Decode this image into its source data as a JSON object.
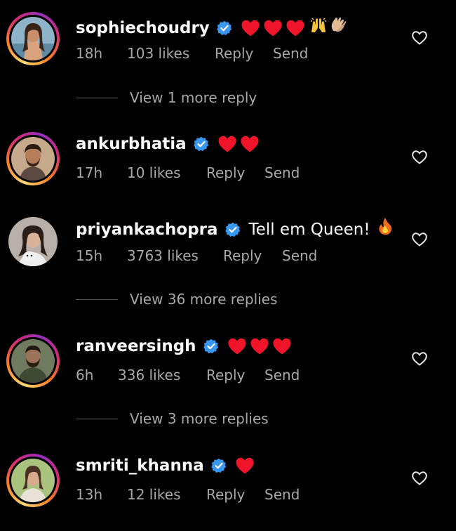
{
  "comments": [
    {
      "username": "sophiechoudry",
      "text": "",
      "emojis": "❤️❤️❤️🙌👏",
      "time": "18h",
      "likes": "103 likes",
      "reply": "Reply",
      "send": "Send",
      "has_story_ring": true,
      "view_replies": "View 1 more reply"
    },
    {
      "username": "ankurbhatia",
      "text": "",
      "emojis": "❤️❤️",
      "time": "17h",
      "likes": "10 likes",
      "reply": "Reply",
      "send": "Send",
      "has_story_ring": true,
      "view_replies": ""
    },
    {
      "username": "priyankachopra",
      "text": "Tell em Queen!",
      "emojis": "🔥",
      "time": "15h",
      "likes": "3763 likes",
      "reply": "Reply",
      "send": "Send",
      "has_story_ring": false,
      "view_replies": "View 36 more replies"
    },
    {
      "username": "ranveersingh",
      "text": "",
      "emojis": "❤️❤️❤️",
      "time": "6h",
      "likes": "336 likes",
      "reply": "Reply",
      "send": "Send",
      "has_story_ring": true,
      "view_replies": "View 3 more replies"
    },
    {
      "username": "smriti_khanna",
      "text": "",
      "emojis": "❤️",
      "time": "13h",
      "likes": "12 likes",
      "reply": "Reply",
      "send": "Send",
      "has_story_ring": true,
      "view_replies": ""
    }
  ],
  "colors": {
    "background": "#000000",
    "verified_badge": "#3897f0",
    "heart_emoji": "#f0142a",
    "meta_text": "#a8a8a8"
  },
  "icons": {
    "verified": "verified-badge-icon",
    "like": "heart-outline-icon",
    "heart_emoji": "red-heart-emoji",
    "raising_hands": "raising-hands-emoji",
    "clapping_hands": "clapping-hands-emoji",
    "fire": "fire-emoji"
  }
}
